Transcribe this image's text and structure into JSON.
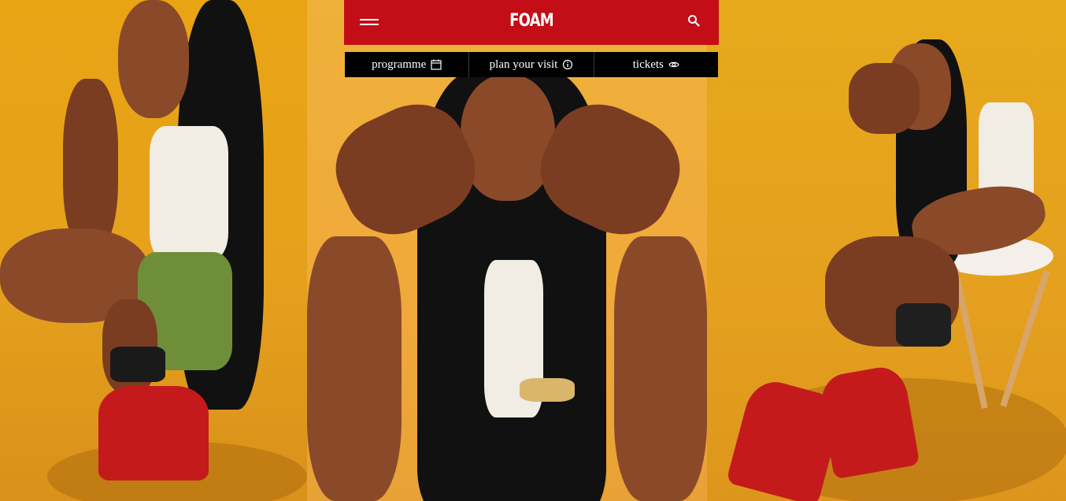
{
  "header": {
    "logo": "FOAM",
    "menu_icon": "hamburger-menu-icon",
    "search_icon": "search-icon",
    "background_color": "#c30d17"
  },
  "nav": {
    "items": [
      {
        "label": "programme",
        "icon": "calendar-icon"
      },
      {
        "label": "plan your visit",
        "icon": "info-icon"
      },
      {
        "label": "tickets",
        "icon": "eye-icon"
      }
    ]
  },
  "colors": {
    "accent": "#c30d17",
    "background": "#e6a21a",
    "nav_background": "#000000",
    "text": "#ffffff"
  }
}
